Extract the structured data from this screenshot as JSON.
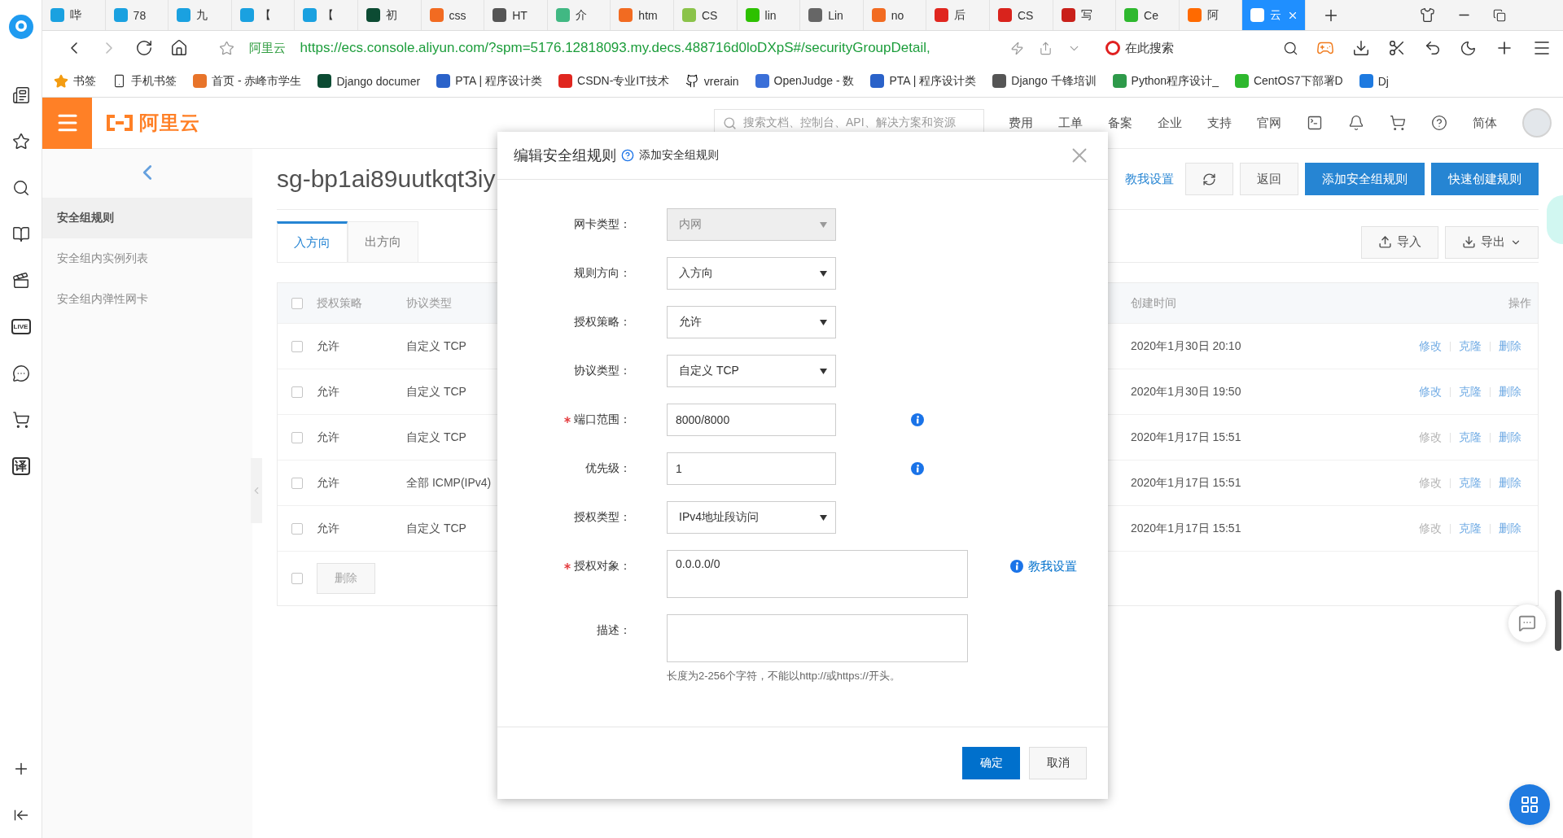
{
  "browser_rail": {
    "items": [
      {
        "kind": "logo"
      },
      {
        "kind": "list"
      },
      {
        "kind": "star"
      },
      {
        "kind": "search"
      },
      {
        "kind": "book"
      },
      {
        "kind": "video"
      },
      {
        "kind": "text",
        "label": "LIVE"
      },
      {
        "kind": "chat"
      },
      {
        "kind": "cart"
      },
      {
        "kind": "text",
        "label": "译"
      }
    ],
    "bottom": [
      {
        "kind": "plus"
      },
      {
        "kind": "collapse"
      }
    ]
  },
  "tabs": [
    {
      "title": "哔",
      "color": "#1aa1e0",
      "selected": false
    },
    {
      "title": "78",
      "color": "#1aa1e0",
      "selected": false
    },
    {
      "title": "九",
      "color": "#1aa1e0",
      "selected": false
    },
    {
      "title": "【",
      "color": "#1aa1e0",
      "selected": false
    },
    {
      "title": "【",
      "color": "#1aa1e0",
      "selected": false
    },
    {
      "title": "初",
      "color": "#0c4b33",
      "selected": false
    },
    {
      "title": "css",
      "color": "#f26b21",
      "selected": false
    },
    {
      "title": "HT",
      "color": "#555555",
      "selected": false
    },
    {
      "title": "介",
      "color": "#41b883",
      "selected": false
    },
    {
      "title": "htm",
      "color": "#f26b21",
      "selected": false
    },
    {
      "title": "CS",
      "color": "#8bc34a",
      "selected": false
    },
    {
      "title": "lin",
      "color": "#2dc100",
      "selected": false
    },
    {
      "title": "Lin",
      "color": "#666666",
      "selected": false
    },
    {
      "title": "no",
      "color": "#f26b21",
      "selected": false
    },
    {
      "title": "后",
      "color": "#e0261f",
      "selected": false
    },
    {
      "title": "CS",
      "color": "#d9231c",
      "selected": false
    },
    {
      "title": "写",
      "color": "#c9201a",
      "selected": false
    },
    {
      "title": "Ce",
      "color": "#2eb82e",
      "selected": false
    },
    {
      "title": "阿",
      "color": "#ff6a00",
      "selected": false
    },
    {
      "title": "云",
      "color": "#ffffff",
      "selected": true
    }
  ],
  "address_bar": {
    "site_label": "阿里云",
    "url": "https://ecs.console.aliyun.com/?spm=5176.12818093.my.decs.488716d0loDXpS#/securityGroupDetail,",
    "search_placeholder": "在此搜索"
  },
  "bookmarks": [
    {
      "title": "书签",
      "kind": "star"
    },
    {
      "title": "手机书签",
      "kind": "phone"
    },
    {
      "title": "首页 - 赤峰市学生",
      "kind": "favicon",
      "color": "#e8742a"
    },
    {
      "title": "Django documer",
      "kind": "favicon",
      "color": "#0c4b33"
    },
    {
      "title": "PTA | 程序设计类",
      "kind": "favicon",
      "color": "#2a62c9"
    },
    {
      "title": "CSDN-专业IT技术",
      "kind": "favicon",
      "color": "#e0261f"
    },
    {
      "title": "vrerain",
      "kind": "github"
    },
    {
      "title": "OpenJudge - 数",
      "kind": "favicon",
      "color": "#3a6fd8"
    },
    {
      "title": "PTA | 程序设计类",
      "kind": "favicon",
      "color": "#2a62c9"
    },
    {
      "title": "Django 千锋培训",
      "kind": "favicon",
      "color": "#555555"
    },
    {
      "title": "Python程序设计_",
      "kind": "favicon",
      "color": "#2e9a4a"
    },
    {
      "title": "CentOS7下部署D",
      "kind": "favicon",
      "color": "#2eb82e"
    },
    {
      "title": "Dj",
      "kind": "favicon",
      "color": "#1e7ae0"
    }
  ],
  "app_header": {
    "logo": "阿里云",
    "search_placeholder": "搜索文档、控制台、API、解决方案和资源",
    "nav": [
      "费用",
      "工单",
      "备案",
      "企业",
      "支持",
      "官网"
    ],
    "language": "简体"
  },
  "sidebar": {
    "items": [
      {
        "label": "安全组规则",
        "selected": true
      },
      {
        "label": "安全组内实例列表",
        "selected": false
      },
      {
        "label": "安全组内弹性网卡",
        "selected": false
      }
    ]
  },
  "page": {
    "title": "sg-bp1ai89uutkqt3iy",
    "help_link": "教我设置",
    "buttons": [
      {
        "label": "返回",
        "kind": "plain"
      },
      {
        "label": "添加安全组规则",
        "kind": "primary"
      },
      {
        "label": "快速创建规则",
        "kind": "primary"
      }
    ],
    "direction_tabs": [
      {
        "label": "入方向",
        "selected": true
      },
      {
        "label": "出方向",
        "selected": false
      }
    ],
    "tools": [
      {
        "label": "导入",
        "kind": "import"
      },
      {
        "label": "导出",
        "kind": "export"
      }
    ]
  },
  "table": {
    "header_checked": false,
    "columns": [
      "授权策略",
      "协议类型",
      "创建时间",
      "操作"
    ],
    "rows": [
      {
        "checked": false,
        "policy": "允许",
        "protocol": "自定义 TCP",
        "created": "2020年1月30日 20:10",
        "actions": [
          {
            "label": "修改",
            "disabled": false
          },
          {
            "label": "克隆",
            "disabled": false
          },
          {
            "label": "删除",
            "disabled": false
          }
        ]
      },
      {
        "checked": false,
        "policy": "允许",
        "protocol": "自定义 TCP",
        "created": "2020年1月30日 19:50",
        "actions": [
          {
            "label": "修改",
            "disabled": false
          },
          {
            "label": "克隆",
            "disabled": false
          },
          {
            "label": "删除",
            "disabled": false
          }
        ]
      },
      {
        "checked": false,
        "policy": "允许",
        "protocol": "自定义 TCP",
        "created": "2020年1月17日 15:51",
        "actions": [
          {
            "label": "修改",
            "disabled": true
          },
          {
            "label": "克隆",
            "disabled": false
          },
          {
            "label": "删除",
            "disabled": false
          }
        ]
      },
      {
        "checked": false,
        "policy": "允许",
        "protocol": "全部 ICMP(IPv4)",
        "created": "2020年1月17日 15:51",
        "actions": [
          {
            "label": "修改",
            "disabled": true
          },
          {
            "label": "克隆",
            "disabled": false
          },
          {
            "label": "删除",
            "disabled": false
          }
        ]
      },
      {
        "checked": false,
        "policy": "允许",
        "protocol": "自定义 TCP",
        "created": "2020年1月17日 15:51",
        "actions": [
          {
            "label": "修改",
            "disabled": true
          },
          {
            "label": "克隆",
            "disabled": false
          },
          {
            "label": "删除",
            "disabled": false
          }
        ]
      }
    ],
    "footer_checked": false,
    "footer_button": {
      "label": "删除",
      "disabled": true
    }
  },
  "dialog": {
    "title": "编辑安全组规则",
    "subtitle": "添加安全组规则",
    "fields": [
      {
        "label": "网卡类型：",
        "kind": "select",
        "value": "内网",
        "disabled": true,
        "required": false
      },
      {
        "label": "规则方向：",
        "kind": "select",
        "value": "入方向",
        "disabled": false,
        "required": false
      },
      {
        "label": "授权策略：",
        "kind": "select",
        "value": "允许",
        "disabled": false,
        "required": false
      },
      {
        "label": "协议类型：",
        "kind": "select",
        "value": "自定义 TCP",
        "disabled": false,
        "required": false
      },
      {
        "label": "端口范围：",
        "kind": "input",
        "value": "8000/8000",
        "disabled": false,
        "required": true,
        "info": true
      },
      {
        "label": "优先级：",
        "kind": "input",
        "value": "1",
        "disabled": false,
        "required": false,
        "info": true
      },
      {
        "label": "授权类型：",
        "kind": "select",
        "value": "IPv4地址段访问",
        "disabled": false,
        "required": false
      },
      {
        "label": "授权对象：",
        "kind": "textarea",
        "value": "0.0.0.0/0",
        "disabled": false,
        "required": true,
        "link": "教我设置"
      },
      {
        "label": "描述：",
        "kind": "textarea",
        "disabled": false,
        "required": false,
        "hint": "长度为2-256个字符，不能以http://或https://开头。"
      }
    ],
    "buttons": [
      {
        "label": "确定",
        "kind": "primary"
      },
      {
        "label": "取消",
        "kind": "plain"
      }
    ]
  }
}
